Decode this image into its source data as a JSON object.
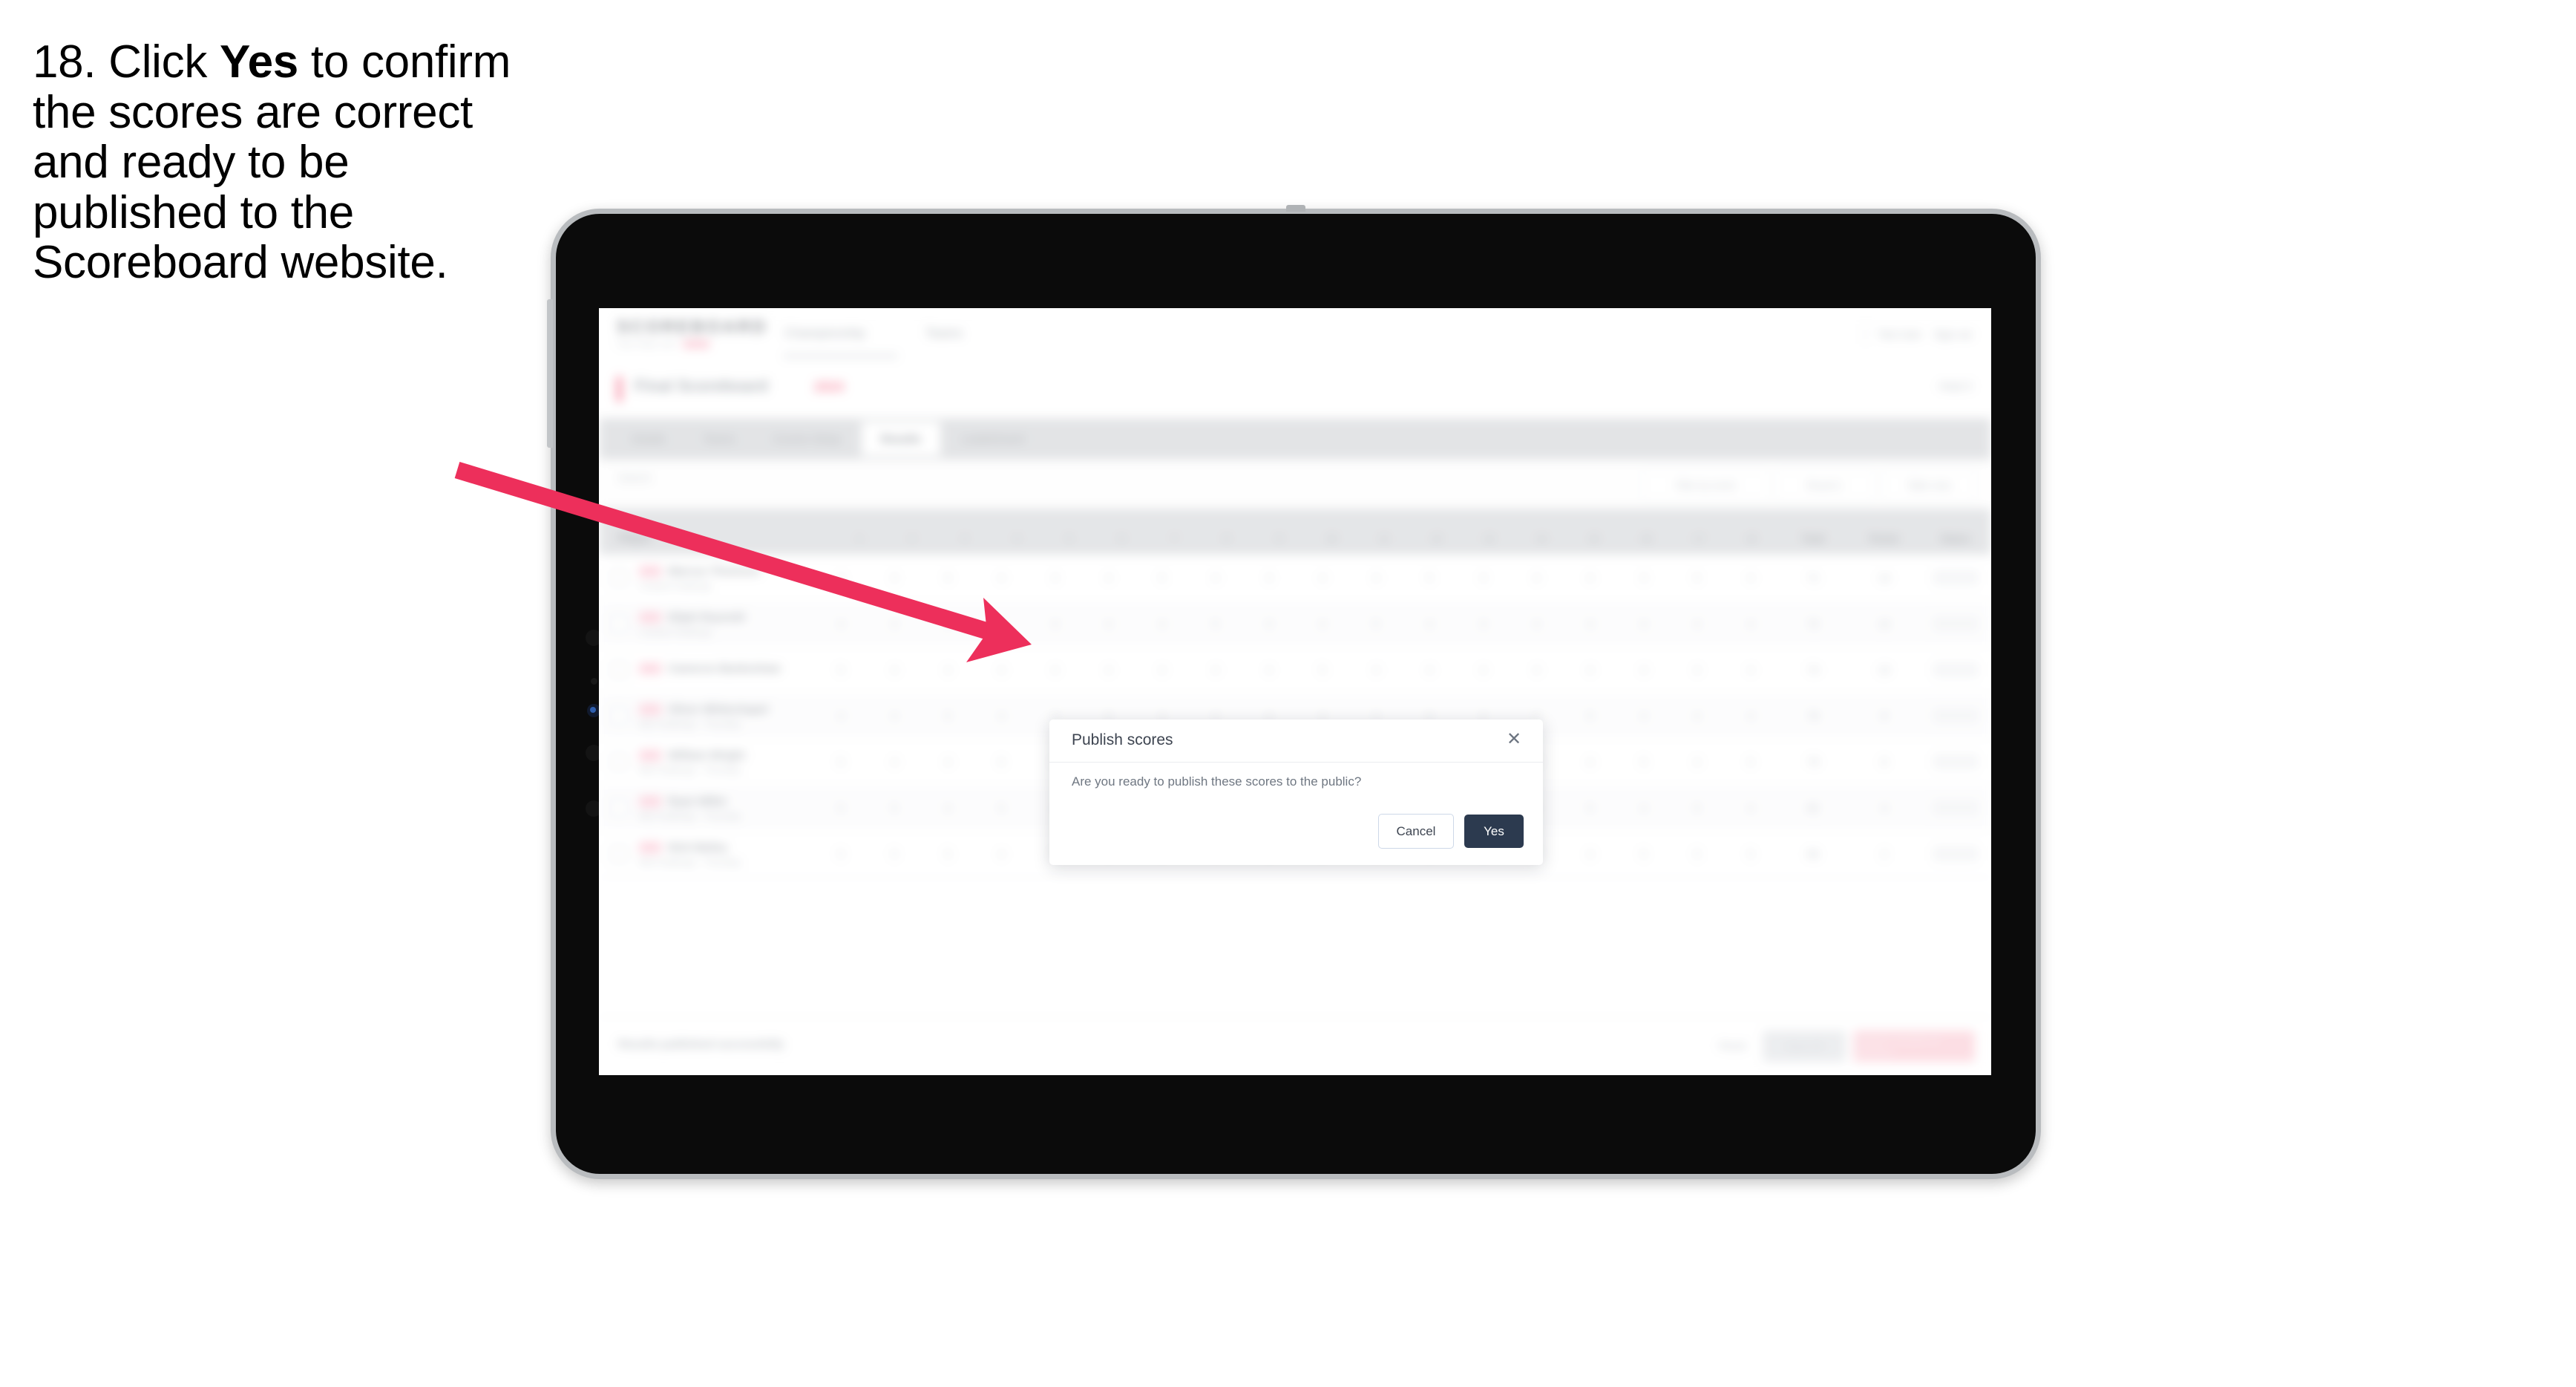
{
  "instruction": {
    "step_number": "18.",
    "text_before": " Click ",
    "bold_word": "Yes",
    "text_after": " to confirm the scores are correct and ready to be published to the Scoreboard website."
  },
  "colors": {
    "arrow": "#ED2F5B",
    "accent_pink": "#F4607F",
    "primary_dark": "#2C3A4F",
    "cancel_border": "#CDD8E8",
    "device_bezel": "#B9BCBF",
    "device_body": "#0B0B0B",
    "tabbar_bg": "#D5D7DA"
  },
  "app": {
    "brand": {
      "word": "SCOREBOARD",
      "tagline": "THE FINAL SAY",
      "pill_label": ""
    },
    "topnav": [
      {
        "label": "Championship"
      },
      {
        "label": "Teams"
      }
    ],
    "topnav_right": [
      {
        "label": "Test User"
      },
      {
        "label": "Sign out"
      }
    ],
    "title": {
      "main": "Final Scoreboard",
      "sub": "2024",
      "right": "Heat 3"
    },
    "tabs": [
      {
        "label": "Details",
        "active": false
      },
      {
        "label": "Teams",
        "active": false
      },
      {
        "label": "Course Setup",
        "active": false
      },
      {
        "label": "Results",
        "active": true
      },
      {
        "label": "Leaderboard",
        "active": false
      }
    ],
    "filters": {
      "search_placeholder": "Search",
      "controls": [
        {
          "label": "Filter by event"
        },
        {
          "label": "Round 1"
        },
        {
          "label": "Table view"
        }
      ]
    },
    "table": {
      "headers": {
        "player": "Player",
        "numbers": [
          "1",
          "2",
          "3",
          "4",
          "5",
          "6",
          "7",
          "8",
          "9",
          "10",
          "11",
          "12",
          "13",
          "14",
          "15",
          "16",
          "17",
          "18"
        ],
        "wide": [
          "Total",
          "Points",
          "Status"
        ]
      },
      "rows": [
        {
          "badge": "",
          "name": "Marcus Thomson",
          "sub": "Coastal Challenge",
          "nums": [
            "4",
            "3",
            "5",
            "4",
            "3",
            "4",
            "5",
            "4",
            "3",
            "4",
            "4",
            "5",
            "3",
            "4",
            "4",
            "3",
            "5",
            "4"
          ],
          "total": "71",
          "points": "14",
          "status": ""
        },
        {
          "badge": "",
          "name": "Elijah Reynold",
          "sub": "Coastal Challenge",
          "nums": [
            "4",
            "4",
            "4",
            "5",
            "3",
            "4",
            "4",
            "5",
            "3",
            "4",
            "5",
            "4",
            "3",
            "4",
            "4",
            "4",
            "4",
            "4"
          ],
          "total": "72",
          "points": "12",
          "status": ""
        },
        {
          "badge": "",
          "name": "Cameron Bankeshaw",
          "sub": "",
          "nums": [
            "5",
            "4",
            "4",
            "4",
            "4",
            "4",
            "4",
            "4",
            "4",
            "5",
            "4",
            "4",
            "4",
            "4",
            "4",
            "4",
            "4",
            "4"
          ],
          "total": "74",
          "points": "10",
          "status": ""
        },
        {
          "badge": "",
          "name": "Oliver Whitechapel",
          "sub": "Mid Challenge - Thursday",
          "nums": [
            "4",
            "4",
            "5",
            "4",
            "4",
            "5",
            "4",
            "4",
            "4",
            "4",
            "4",
            "5",
            "4",
            "4",
            "5",
            "4",
            "4",
            "4"
          ],
          "total": "76",
          "points": "8",
          "status": ""
        },
        {
          "badge": "",
          "name": "William Wright",
          "sub": "Mid Challenge - Thursday",
          "nums": [
            "5",
            "4",
            "4",
            "5",
            "4",
            "4",
            "5",
            "4",
            "5",
            "4",
            "4",
            "4",
            "5",
            "4",
            "4",
            "5",
            "4",
            "5"
          ],
          "total": "79",
          "points": "6",
          "status": ""
        },
        {
          "badge": "",
          "name": "Ryan Miller",
          "sub": "Mid Challenge - Thursday",
          "nums": [
            "5",
            "5",
            "4",
            "5",
            "4",
            "5",
            "4",
            "5",
            "4",
            "5",
            "5",
            "4",
            "5",
            "4",
            "5",
            "4",
            "5",
            "4"
          ],
          "total": "82",
          "points": "4",
          "status": ""
        },
        {
          "badge": "",
          "name": "Nick Bailey",
          "sub": "Mid Challenge - Thursday",
          "nums": [
            "5",
            "5",
            "5",
            "4",
            "5",
            "5",
            "5",
            "4",
            "5",
            "5",
            "4",
            "5",
            "5",
            "5",
            "4",
            "5",
            "5",
            "5"
          ],
          "total": "86",
          "points": "2",
          "status": ""
        }
      ]
    },
    "footer": {
      "note": "Results published successfully",
      "link": "Reset",
      "secondary_button": "Save All",
      "primary_button": "Publish results to Website"
    }
  },
  "modal": {
    "title": "Publish scores",
    "close_icon": "close-icon",
    "body": "Are you ready to publish these scores to the public?",
    "cancel_label": "Cancel",
    "confirm_label": "Yes"
  }
}
